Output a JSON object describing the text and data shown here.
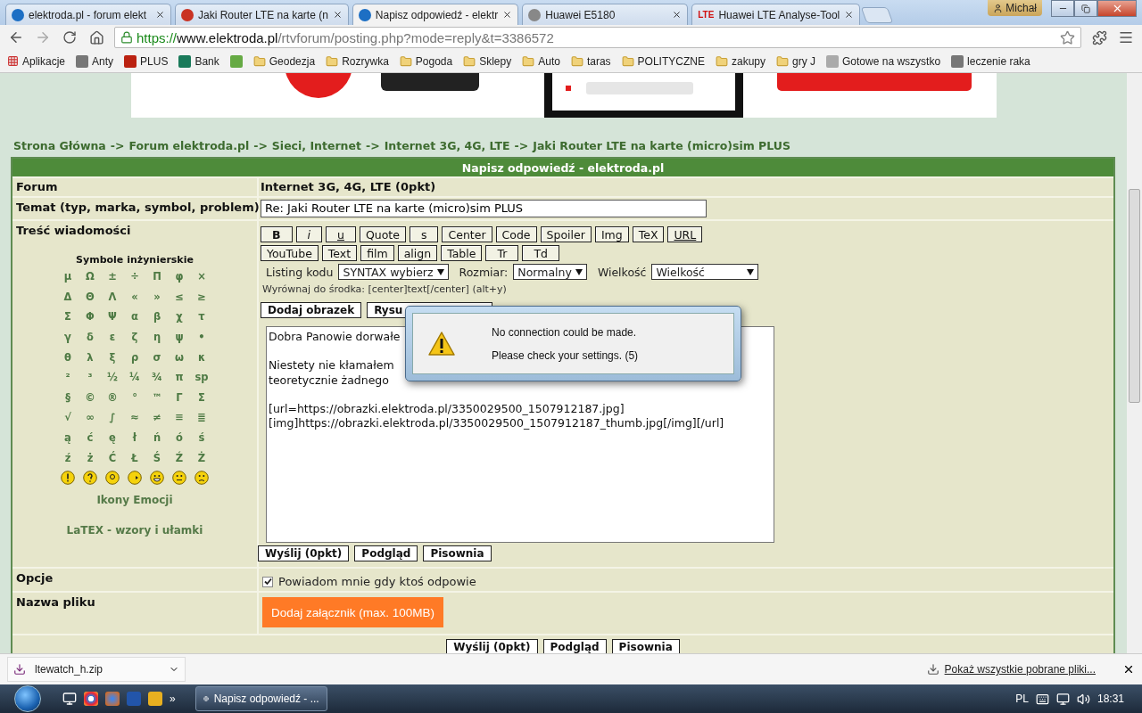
{
  "browser": {
    "tabs": [
      {
        "title": "elektroda.pl - forum elekt",
        "selected": false
      },
      {
        "title": "Jaki Router LTE na karte (n",
        "selected": false
      },
      {
        "title": "Napisz odpowiedź - elektr",
        "selected": true
      },
      {
        "title": "Huawei E5180",
        "selected": false
      },
      {
        "title": "Huawei LTE Analyse-Tool",
        "selected": false,
        "badge": "LTE"
      }
    ],
    "user": "Michał",
    "address": {
      "scheme": "https://",
      "host": "www.elektroda.pl",
      "path": "/rtvforum/posting.php?mode=reply&t=3386572"
    },
    "bookmarks": [
      {
        "kind": "apps",
        "label": "Aplikacje"
      },
      {
        "kind": "site",
        "label": "Anty"
      },
      {
        "kind": "site",
        "label": "PLUS"
      },
      {
        "kind": "site",
        "label": "Bank"
      },
      {
        "kind": "site"
      },
      {
        "kind": "folder",
        "label": "Geodezja"
      },
      {
        "kind": "folder",
        "label": "Rozrywka"
      },
      {
        "kind": "folder",
        "label": "Pogoda"
      },
      {
        "kind": "folder",
        "label": "Sklepy"
      },
      {
        "kind": "folder",
        "label": "Auto"
      },
      {
        "kind": "folder",
        "label": "taras"
      },
      {
        "kind": "folder",
        "label": "POLITYCZNE"
      },
      {
        "kind": "folder",
        "label": "zakupy"
      },
      {
        "kind": "folder",
        "label": "gry J"
      },
      {
        "kind": "site",
        "label": "Gotowe na wszystko"
      },
      {
        "kind": "site",
        "label": "leczenie raka"
      }
    ]
  },
  "breadcrumb": {
    "separator": "->",
    "items": [
      "Strona Główna",
      "Forum elektroda.pl",
      "Sieci, Internet",
      "Internet 3G, 4G, LTE",
      "Jaki Router LTE na karte (micro)sim PLUS"
    ]
  },
  "form": {
    "title": "Napisz odpowiedź - elektroda.pl",
    "forum": {
      "label": "Forum",
      "value": "Internet 3G, 4G, LTE (0pkt)"
    },
    "subject": {
      "label": "Temat (typ, marka, symbol, problem)",
      "value": "Re: Jaki Router LTE na karte (micro)sim PLUS"
    },
    "message": {
      "label": "Treść wiadomości",
      "symbols_title": "Symbole inżynierskie",
      "symbols": [
        [
          "μ",
          "Ω",
          "±",
          "÷",
          "Π",
          "φ",
          "×"
        ],
        [
          "Δ",
          "Θ",
          "Λ",
          "«",
          "»",
          "≤",
          "≥"
        ],
        [
          "Σ",
          "Φ",
          "Ψ",
          "α",
          "β",
          "χ",
          "τ"
        ],
        [
          "γ",
          "δ",
          "ε",
          "ζ",
          "η",
          "ψ",
          "•"
        ],
        [
          "θ",
          "λ",
          "ξ",
          "ρ",
          "σ",
          "ω",
          "κ"
        ],
        [
          "²",
          "³",
          "½",
          "¼",
          "¾",
          "π",
          "sp"
        ],
        [
          "§",
          "©",
          "®",
          "°",
          "™",
          "Γ",
          "Σ"
        ],
        [
          "√",
          "∞",
          "∫",
          "≈",
          "≠",
          "≡",
          "≣"
        ],
        [
          "ą",
          "ć",
          "ę",
          "ł",
          "ń",
          "ó",
          "ś"
        ],
        [
          "ź",
          "ż",
          "Ć",
          "Ł",
          "Ś",
          "Ź",
          "Ż"
        ]
      ],
      "emoticons_link": "Ikony Emocji",
      "latex_link": "LaTEX - wzory i ułamki",
      "format_buttons": [
        [
          {
            "label": "B",
            "kind": "bold"
          },
          {
            "label": "i",
            "kind": "italic"
          },
          {
            "label": "u",
            "kind": "underline"
          },
          {
            "label": "Quote",
            "kind": "plain"
          },
          {
            "label": "s",
            "kind": "plain"
          },
          {
            "label": "Center",
            "kind": "plain"
          },
          {
            "label": "Code",
            "kind": "plain"
          },
          {
            "label": "Spoiler",
            "kind": "plain"
          },
          {
            "label": "Img",
            "kind": "plain"
          },
          {
            "label": "TeX",
            "kind": "plain"
          },
          {
            "label": "URL",
            "kind": "underline"
          }
        ],
        [
          {
            "label": "YouTube",
            "kind": "plain"
          },
          {
            "label": "Text",
            "kind": "plain"
          },
          {
            "label": "film",
            "kind": "plain"
          },
          {
            "label": "align",
            "kind": "plain"
          },
          {
            "label": "Table",
            "kind": "plain"
          },
          {
            "label": "Tr",
            "kind": "plain"
          },
          {
            "label": "Td",
            "kind": "plain"
          }
        ]
      ],
      "selects": [
        {
          "label": "Listing kodu",
          "value": "SYNTAX wybierz"
        },
        {
          "label": "Rozmiar:",
          "value": "Normalny"
        },
        {
          "label": "Wielkość",
          "value": "Wielkość"
        }
      ],
      "hint": "Wyrównaj do środka: [center]text[/center] (alt+y)",
      "insert_buttons": [
        "Dodaj obrazek",
        "Rysu"
      ],
      "text_paragraphs": [
        [
          "Dobra Panowie dorwałe"
        ],
        [
          "Niestety nie kłamałem",
          "teoretycznie żadnego"
        ],
        [
          "[url=https://obrazki.elektroda.pl/3350029500_1507912187.jpg]",
          "[img]https://obrazki.elektroda.pl/3350029500_1507912187_thumb.jpg[/img][/url]"
        ]
      ],
      "actions": [
        "Wyślij (0pkt)",
        "Podgląd",
        "Pisownia"
      ]
    },
    "options": {
      "label": "Opcje",
      "notify": {
        "label": "Powiadom mnie gdy ktoś odpowie",
        "checked": true
      }
    },
    "attachment": {
      "label": "Nazwa pliku",
      "button": "Dodaj załącznik (max. 100MB)"
    },
    "bottom_actions": [
      "Wyślij (0pkt)",
      "Podgląd",
      "Pisownia"
    ]
  },
  "dialog": {
    "lines": [
      "No connection could be made.",
      "Please check your settings. (5)"
    ]
  },
  "downloads": {
    "file": "ltewatch_h.zip",
    "show_all": "Pokaż wszystkie pobrane pliki..."
  },
  "taskbar": {
    "overflow": "»",
    "task": "Napisz odpowiedź - ...",
    "language": "PL",
    "time": "18:31"
  }
}
